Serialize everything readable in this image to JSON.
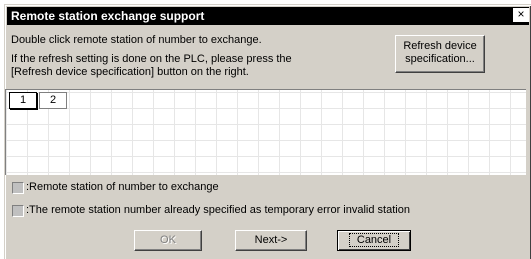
{
  "window": {
    "title": "Remote station exchange support",
    "close_symbol": "×"
  },
  "description": {
    "line1": "Double click remote station of number to exchange.",
    "line2": "If the refresh setting is done on the PLC, please press the",
    "line3": "[Refresh device specification] button on the right."
  },
  "refresh_button": {
    "line1": "Refresh device",
    "line2": "specification..."
  },
  "stations": [
    {
      "label": "1"
    },
    {
      "label": "2"
    }
  ],
  "legend": {
    "item1": ":Remote station of number to exchange",
    "item2": ":The remote station number already specified as temporary error invalid station"
  },
  "buttons": {
    "ok": "OK",
    "next": "Next->",
    "cancel": "Cancel"
  }
}
